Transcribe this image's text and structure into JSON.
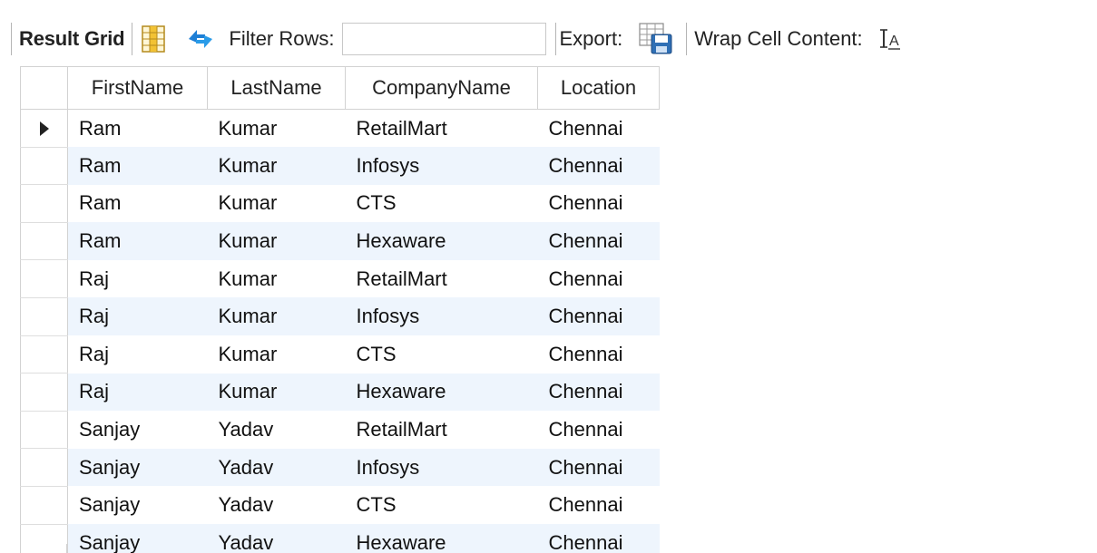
{
  "toolbar": {
    "result_grid_label": "Result Grid",
    "filter_label": "Filter Rows:",
    "filter_value": "",
    "export_label": "Export:",
    "wrap_label": "Wrap Cell Content:",
    "icons": {
      "grid_toggle": "form-editor-grid-icon",
      "refresh": "refresh-icon",
      "export": "export-save-icon",
      "wrap": "wrap-text-icon"
    }
  },
  "grid": {
    "columns": [
      "FirstName",
      "LastName",
      "CompanyName",
      "Location"
    ],
    "current_row_marker": "row-pointer-icon",
    "rows": [
      [
        "Ram",
        "Kumar",
        "RetailMart",
        "Chennai"
      ],
      [
        "Ram",
        "Kumar",
        "Infosys",
        "Chennai"
      ],
      [
        "Ram",
        "Kumar",
        "CTS",
        "Chennai"
      ],
      [
        "Ram",
        "Kumar",
        "Hexaware",
        "Chennai"
      ],
      [
        "Raj",
        "Kumar",
        "RetailMart",
        "Chennai"
      ],
      [
        "Raj",
        "Kumar",
        "Infosys",
        "Chennai"
      ],
      [
        "Raj",
        "Kumar",
        "CTS",
        "Chennai"
      ],
      [
        "Raj",
        "Kumar",
        "Hexaware",
        "Chennai"
      ],
      [
        "Sanjay",
        "Yadav",
        "RetailMart",
        "Chennai"
      ],
      [
        "Sanjay",
        "Yadav",
        "Infosys",
        "Chennai"
      ],
      [
        "Sanjay",
        "Yadav",
        "CTS",
        "Chennai"
      ],
      [
        "Sanjay",
        "Yadav",
        "Hexaware",
        "Chennai"
      ]
    ]
  },
  "colors": {
    "alt_row": "#eef5fd",
    "grid_line": "#d2d2d2",
    "refresh_blue": "#1e7fd6",
    "grid_icon_yellow": "#f2c233"
  }
}
